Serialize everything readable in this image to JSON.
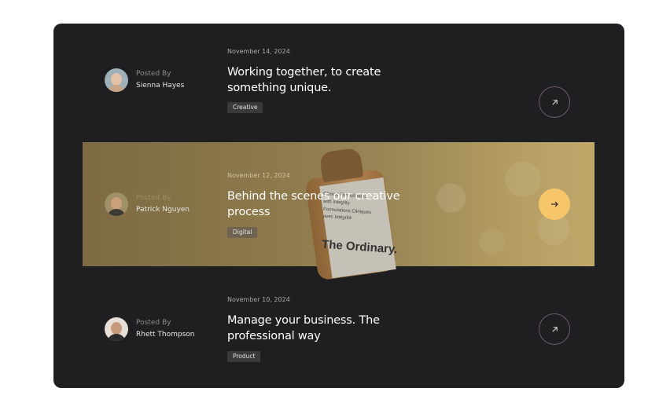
{
  "posts": [
    {
      "posted_by_label": "Posted By",
      "author": "Sienna Hayes",
      "date": "November 14, 2024",
      "title": "Working together, to create something unique.",
      "tag": "Creative",
      "arrow_icon": "arrow-up-right-icon"
    },
    {
      "posted_by_label": "Posted By",
      "author": "Patrick Nguyen",
      "date": "November 12, 2024",
      "title": "Behind the scenes our creative process",
      "tag": "Digital",
      "arrow_icon": "arrow-right-icon",
      "image_brand": "The Ordinary.",
      "image_label_lines": [
        "Clinical Formulations",
        "with Integrity",
        "Formulations Cliniques",
        "avec Intégrité"
      ]
    },
    {
      "posted_by_label": "Posted By",
      "author": "Rhett Thompson",
      "date": "November 10, 2024",
      "title": "Manage your business. The professional way",
      "tag": "Product",
      "arrow_icon": "arrow-up-right-icon"
    }
  ],
  "colors": {
    "panel": "#1f1f21",
    "accent": "#f7c66b",
    "tag_bg": "#3a3a3c"
  }
}
